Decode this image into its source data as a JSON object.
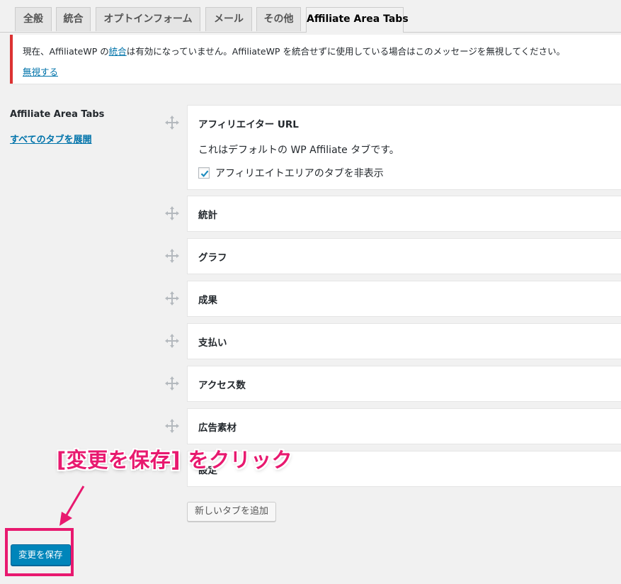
{
  "tabs": [
    {
      "label": "全般"
    },
    {
      "label": "統合"
    },
    {
      "label": "オプトインフォーム"
    },
    {
      "label": "メール"
    },
    {
      "label": "その他"
    },
    {
      "label": "Affiliate Area Tabs"
    }
  ],
  "notice": {
    "text_before": "現在、AffiliateWP の",
    "link": "統合",
    "text_after": "は有効になっていません。AffiliateWP を統合せずに使用している場合はこのメッセージを無視してください。",
    "dismiss": "無視する"
  },
  "section": {
    "title": "Affiliate Area Tabs",
    "expand_all": "すべてのタブを展開"
  },
  "panels": [
    {
      "title": "アフィリエイター URL",
      "description": "これはデフォルトの WP Affiliate タブです。",
      "checkbox_label": "アフィリエイトエリアのタブを非表示",
      "checked": true
    },
    {
      "title": "統計"
    },
    {
      "title": "グラフ"
    },
    {
      "title": "成果"
    },
    {
      "title": "支払い"
    },
    {
      "title": "アクセス数"
    },
    {
      "title": "広告素材"
    },
    {
      "title": "設定"
    }
  ],
  "buttons": {
    "add_tab": "新しいタブを追加",
    "save": "変更を保存"
  },
  "annotation": {
    "text": "[変更を保存] をクリック",
    "color": "#e8196f"
  },
  "colors": {
    "accent": "#0085ba",
    "notice_error": "#dc3232",
    "link": "#0073aa"
  }
}
